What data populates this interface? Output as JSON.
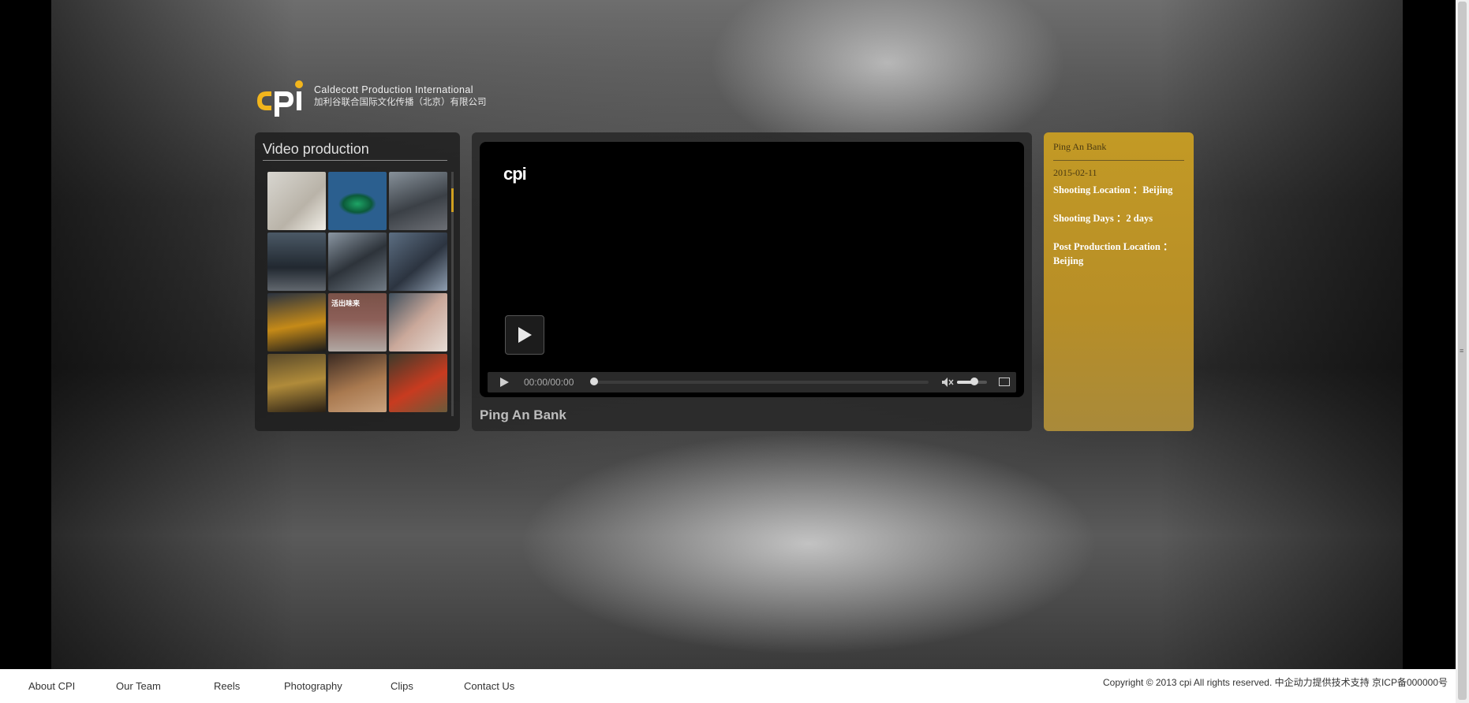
{
  "logo": {
    "mark_text": "cpi",
    "line1": "Caldecott Production International",
    "line2": "加利谷联合国际文化传播（北京）有限公司"
  },
  "left_panel": {
    "title": "Video production",
    "thumbnails": [
      {
        "caption": ""
      },
      {
        "caption": ""
      },
      {
        "caption": ""
      },
      {
        "caption": ""
      },
      {
        "caption": ""
      },
      {
        "caption": ""
      },
      {
        "caption": ""
      },
      {
        "caption": "活出味来"
      },
      {
        "caption": ""
      },
      {
        "caption": ""
      },
      {
        "caption": ""
      },
      {
        "caption": ""
      }
    ]
  },
  "video": {
    "watermark": "cpi",
    "time": "00:00/00:00",
    "progress": 0,
    "volume": 0.6,
    "title": "Ping An Bank"
  },
  "info": {
    "title": "Ping An Bank",
    "date": "2015-02-11",
    "shooting_location": "Shooting Location ：Beijing",
    "shooting_days": "Shooting Days ：2 days",
    "post_location": "Post Production Location ：Beijing"
  },
  "footer": {
    "nav": [
      "About CPI",
      "Our Team",
      "Reels",
      "Photography",
      "Clips",
      "Contact Us"
    ],
    "copyright": "Copyright © 2013 cpi All rights reserved. 中企动力提供技术支持 京ICP备000000号"
  },
  "colors": {
    "accent_gold": "#c39a25",
    "logo_yellow": "#f2b51c"
  }
}
